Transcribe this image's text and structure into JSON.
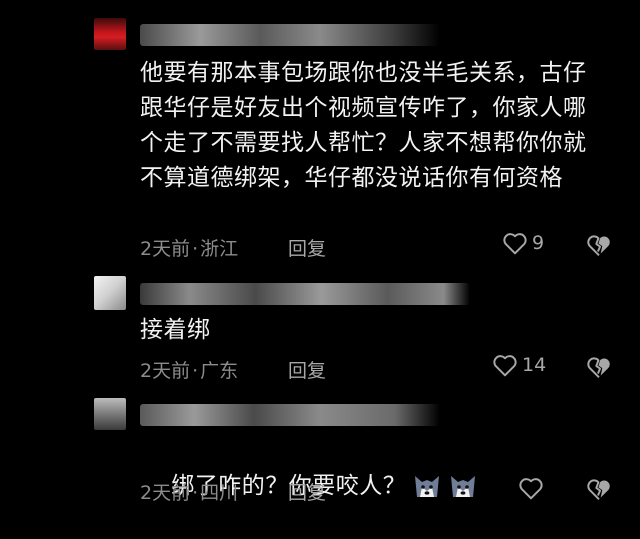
{
  "comments": [
    {
      "text": "他要有那本事包场跟你也没半毛关系，古仔跟华仔是好友出个视频宣传咋了，你家人哪个走了不需要找人帮忙？人家不想帮你你就不算道德绑架，华仔都没说话你有何资格",
      "time": "2天前",
      "location": "浙江",
      "reply_label": "回复",
      "likes": "9"
    },
    {
      "text": "接着绑",
      "time": "2天前",
      "location": "广东",
      "reply_label": "回复",
      "likes": "14"
    },
    {
      "text": "绑了咋的？你要咬人？",
      "time": "2天前",
      "location": "四川",
      "reply_label": "回复",
      "likes": ""
    }
  ],
  "separator": "·",
  "icons": {
    "like": "heart-outline-icon",
    "dislike": "broken-heart-icon",
    "emoji": "husky-dog-emoji"
  },
  "colors": {
    "background": "#000000",
    "text": "#f2f2f2",
    "meta": "#8c8c8c"
  }
}
